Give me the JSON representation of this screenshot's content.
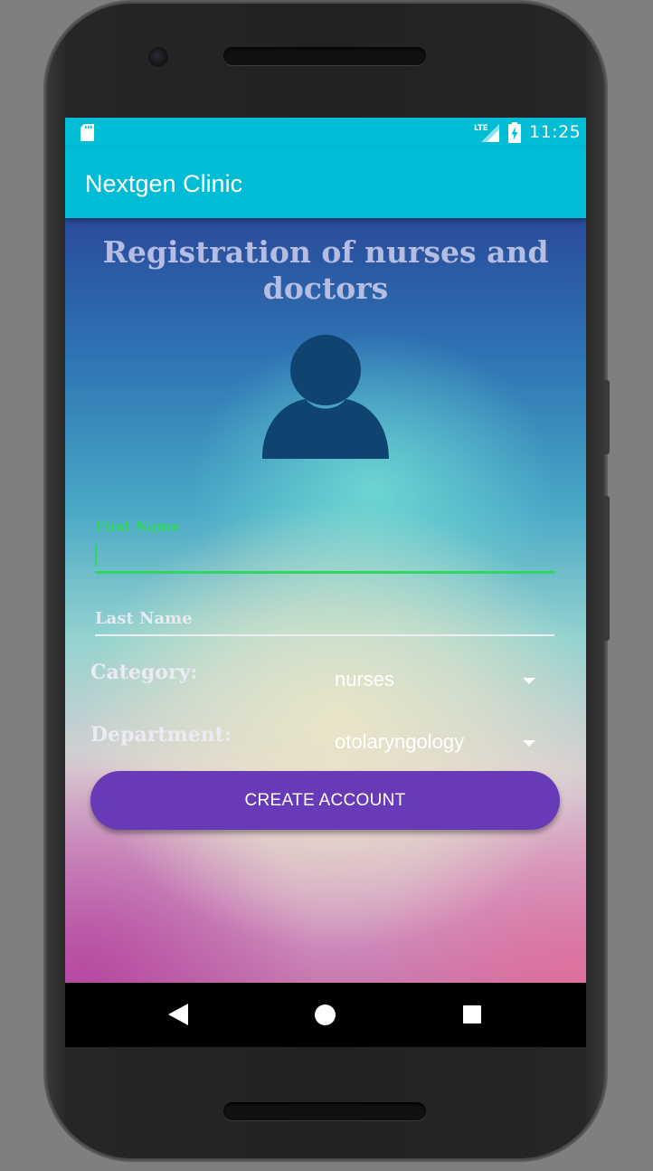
{
  "status_bar": {
    "time": "11:25",
    "network": "LTE",
    "icons": [
      "sd-card-icon",
      "lte-signal-icon",
      "battery-charging-icon"
    ]
  },
  "app_bar": {
    "title": "Nextgen Clinic",
    "color": "#00bcd4"
  },
  "form": {
    "heading": "Registration of nurses and doctors",
    "avatar_icon": "person-icon",
    "avatar_color": "#0f4471",
    "first_name": {
      "label": "First Name",
      "value": "",
      "accent_color": "#31d661"
    },
    "last_name": {
      "placeholder": "Last Name",
      "value": ""
    },
    "category": {
      "label": "Category:",
      "selected": "nurses"
    },
    "department": {
      "label": "Department:",
      "selected": "otolaryngology"
    },
    "submit": {
      "label": "CREATE ACCOUNT",
      "color": "#673ab7"
    }
  },
  "nav_bar": {
    "icons": [
      "back-icon",
      "home-icon",
      "recents-icon"
    ]
  }
}
